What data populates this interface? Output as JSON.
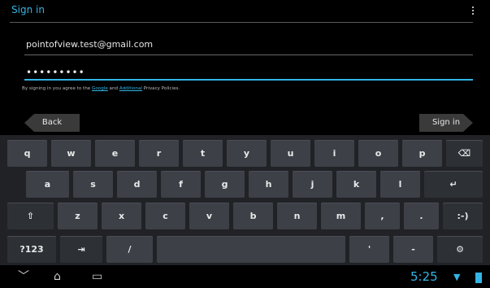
{
  "screen": {
    "title": "Sign in",
    "email": "pointofview.test@gmail.com",
    "password_mask": "•••••••••",
    "legal": {
      "prefix": "By signing in you agree to the ",
      "google": "Google",
      "and": " and ",
      "additional": "Additional",
      "suffix": " Privacy Policies."
    },
    "back_label": "Back",
    "signin_label": "Sign in"
  },
  "keyboard": {
    "row1": [
      "q",
      "w",
      "e",
      "r",
      "t",
      "y",
      "u",
      "i",
      "o",
      "p"
    ],
    "row2": [
      "a",
      "s",
      "d",
      "f",
      "g",
      "h",
      "j",
      "k",
      "l"
    ],
    "row3": [
      "z",
      "x",
      "c",
      "v",
      "b",
      "n",
      "m",
      ",",
      "."
    ],
    "mode_label": "?123",
    "tab_label": "⇥",
    "slash_label": "/",
    "apostrophe_label": "'",
    "dash_label": "-",
    "settings_label": "⚙",
    "smiley_label": ":-)",
    "enter_label": "↵",
    "backspace_label": "⌫",
    "shift_label": "⇧"
  },
  "statusbar": {
    "time": "5:25"
  },
  "colors": {
    "accent": "#33b5e5",
    "key": "#3d4047",
    "keyboard_bg": "#202226"
  }
}
